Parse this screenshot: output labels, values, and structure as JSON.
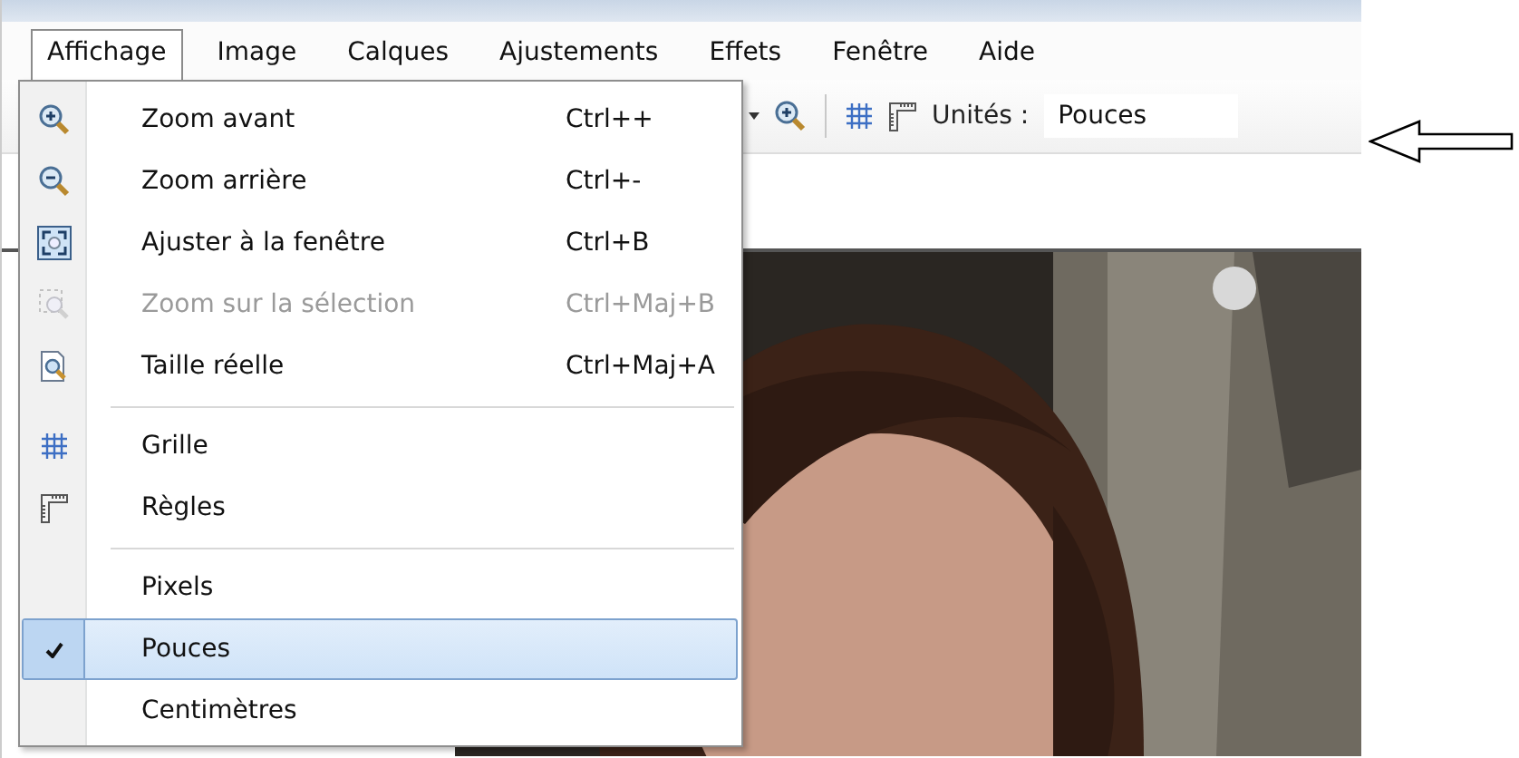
{
  "menu_bar": [
    {
      "label": "Affichage",
      "selected": true
    },
    {
      "label": "Image",
      "selected": false
    },
    {
      "label": "Calques",
      "selected": false
    },
    {
      "label": "Ajustements",
      "selected": false
    },
    {
      "label": "Effets",
      "selected": false
    },
    {
      "label": "Fenêtre",
      "selected": false
    },
    {
      "label": "Aide",
      "selected": false
    }
  ],
  "toolbar": {
    "units_label": "Unités :",
    "units_value": "Pouces"
  },
  "view_menu": [
    {
      "kind": "command",
      "label": "Zoom avant",
      "shortcut": "Ctrl++",
      "disabled": false
    },
    {
      "kind": "command",
      "label": "Zoom arrière",
      "shortcut": "Ctrl+-",
      "disabled": false
    },
    {
      "kind": "command",
      "label": "Ajuster à la fenêtre",
      "shortcut": "Ctrl+B",
      "disabled": false
    },
    {
      "kind": "command",
      "label": "Zoom sur la sélection",
      "shortcut": "Ctrl+Maj+B",
      "disabled": true
    },
    {
      "kind": "command",
      "label": "Taille réelle",
      "shortcut": "Ctrl+Maj+A",
      "disabled": false
    },
    {
      "kind": "separator"
    },
    {
      "kind": "command",
      "label": "Grille",
      "disabled": false
    },
    {
      "kind": "command",
      "label": "Règles",
      "disabled": false
    },
    {
      "kind": "separator"
    },
    {
      "kind": "option",
      "label": "Pixels",
      "checked": false,
      "selected": false
    },
    {
      "kind": "option",
      "label": "Pouces",
      "checked": true,
      "selected": true
    },
    {
      "kind": "option",
      "label": "Centimètres",
      "checked": false,
      "selected": false
    }
  ]
}
